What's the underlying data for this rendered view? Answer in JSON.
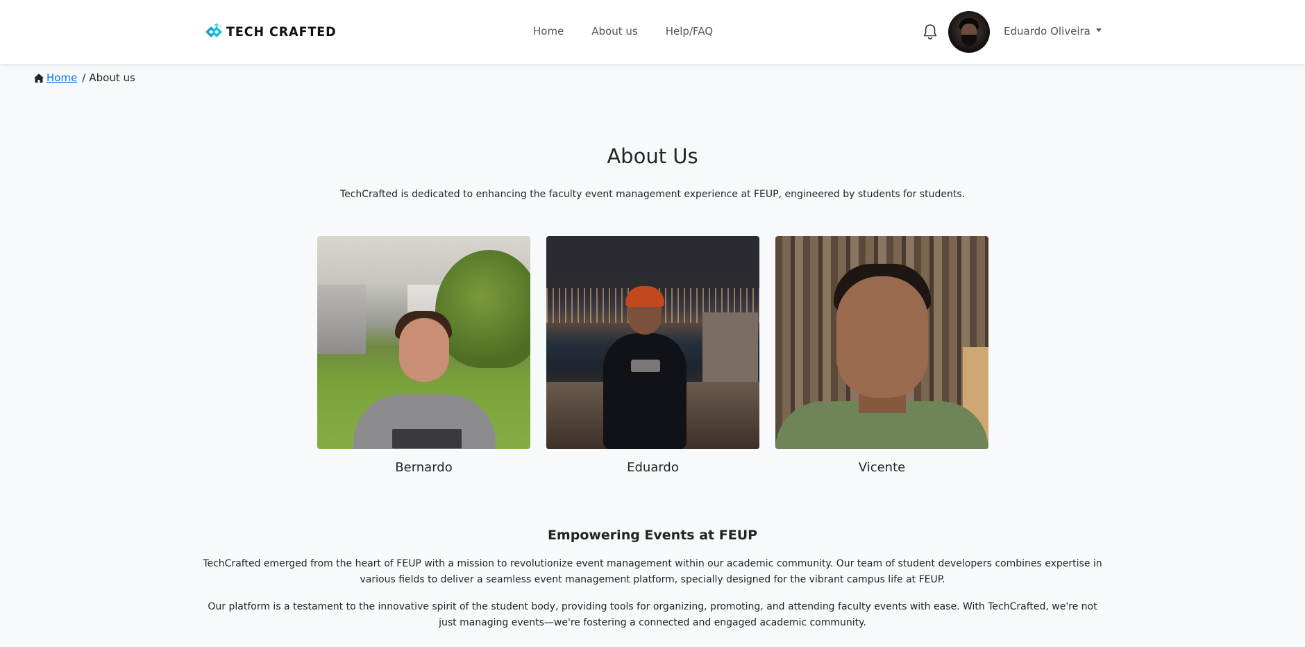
{
  "brand": {
    "name": "TECH CRAFTED",
    "accent": "#1fb6c9"
  },
  "nav": {
    "links": [
      {
        "label": "Home"
      },
      {
        "label": "About us"
      },
      {
        "label": "Help/FAQ"
      }
    ],
    "user": {
      "name": "Eduardo Oliveira"
    },
    "icons": {
      "bell": "bell-icon",
      "caret": "caret-down-icon"
    }
  },
  "breadcrumb": {
    "home": "Home",
    "separator": "/",
    "current": "About us"
  },
  "page": {
    "title": "About Us",
    "lead": "TechCrafted is dedicated to enhancing the faculty event management experience at FEUP, engineered by students for students."
  },
  "team": [
    {
      "name": "Bernardo"
    },
    {
      "name": "Eduardo"
    },
    {
      "name": "Vicente"
    }
  ],
  "mission": {
    "title": "Empowering Events at FEUP",
    "paragraphs": [
      "TechCrafted emerged from the heart of FEUP with a mission to revolutionize event management within our academic community. Our team of student developers combines expertise in various fields to deliver a seamless event management platform, specially designed for the vibrant campus life at FEUP.",
      "Our platform is a testament to the innovative spirit of the student body, providing tools for organizing, promoting, and attending faculty events with ease. With TechCrafted, we're not just managing events—we're fostering a connected and engaged academic community."
    ]
  },
  "colors": {
    "link": "#0d6efd",
    "background": "#f8f9fa",
    "navbar": "#ffffff"
  }
}
